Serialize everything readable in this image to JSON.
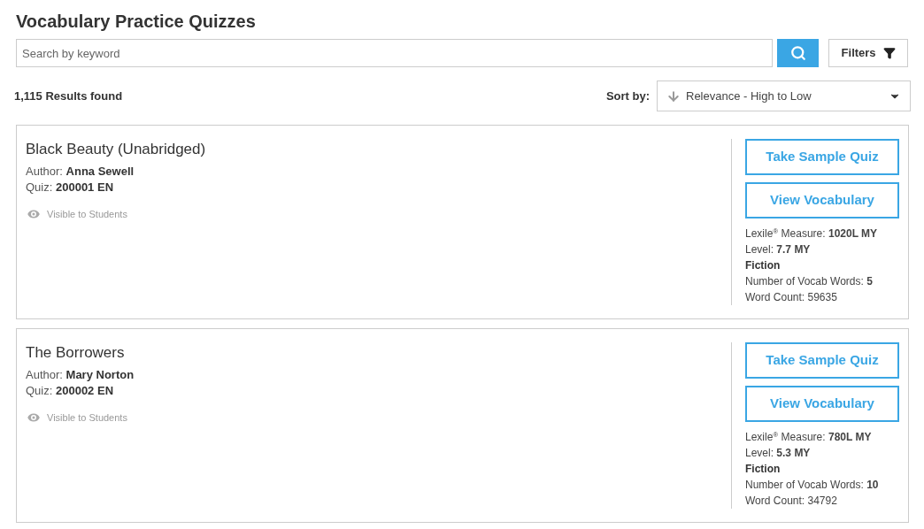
{
  "title": "Vocabulary Practice Quizzes",
  "search": {
    "placeholder": "Search by keyword"
  },
  "filters_button": "Filters",
  "results": "1,115 Results found",
  "sort": {
    "label": "Sort by:",
    "value": "Relevance - High to Low"
  },
  "quizzes": [
    {
      "title": "Black Beauty (Unabridged)",
      "author_label": "Author:",
      "author": "Anna Sewell",
      "quiz_label": "Quiz:",
      "quiz": "200001 EN",
      "visibility": "Visible to Students",
      "buttons": [
        "Take Sample Quiz",
        "View Vocabulary"
      ],
      "details": [
        {
          "kind": "plain",
          "text": "Lexile$^{®}$ Measure: **1020L MY**"
        },
        {
          "kind": "plain",
          "text": "Level: **7.7 MY**"
        },
        {
          "kind": "genre",
          "text": "Fiction"
        },
        {
          "kind": "plain",
          "text": "Number of Vocab Words: **5**"
        },
        {
          "kind": "plain",
          "text": "Word Count: 59635"
        }
      ]
    },
    {
      "title": "The Borrowers",
      "author_label": "Author:",
      "author": "Mary Norton",
      "quiz_label": "Quiz:",
      "quiz": "200002 EN",
      "visibility": "Visible to Students",
      "buttons": [
        "Take Sample Quiz",
        "View Vocabulary"
      ],
      "details": [
        {
          "kind": "plain",
          "text": "Lexile$^{®}$ Measure: **780L MY**"
        },
        {
          "kind": "plain",
          "text": "Level: **5.3 MY**"
        },
        {
          "kind": "genre",
          "text": "Fiction"
        },
        {
          "kind": "plain",
          "text": "Number of Vocab Words: **10**"
        },
        {
          "kind": "plain",
          "text": "Word Count: 34792"
        }
      ]
    }
  ]
}
